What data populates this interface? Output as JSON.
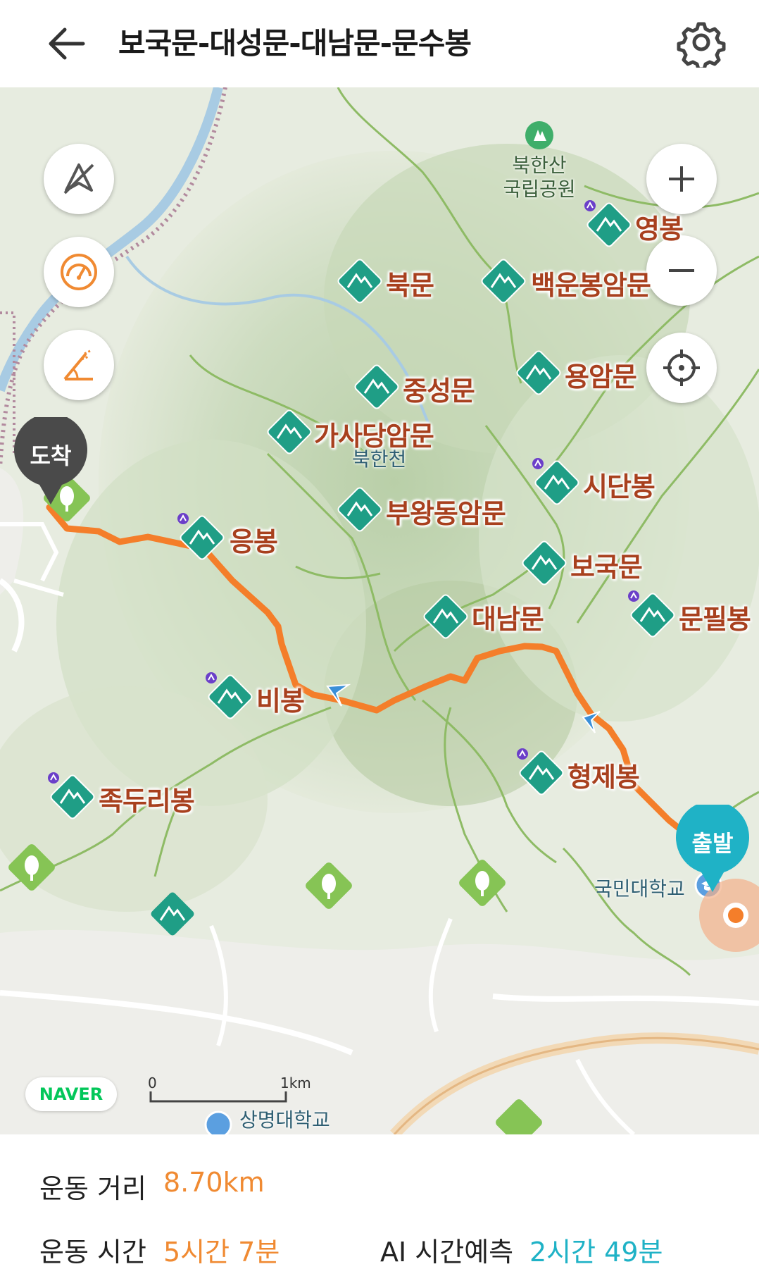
{
  "header": {
    "title": "보국문-대성문-대남문-문수봉"
  },
  "map": {
    "park_label": [
      "북한산",
      "국립공원"
    ],
    "stream_label": "북한천",
    "school_labels": [
      "국민대학교",
      "상명대학교"
    ],
    "peaks": [
      {
        "label": "영봉"
      },
      {
        "label": "북문"
      },
      {
        "label": "백운봉암문"
      },
      {
        "label": "용암문"
      },
      {
        "label": "중성문"
      },
      {
        "label": "가사당암문"
      },
      {
        "label": "시단봉"
      },
      {
        "label": "부왕동암문"
      },
      {
        "label": "응봉"
      },
      {
        "label": "보국문"
      },
      {
        "label": "대남문"
      },
      {
        "label": "문필봉"
      },
      {
        "label": "비봉"
      },
      {
        "label": "형제봉"
      },
      {
        "label": "족두리봉"
      }
    ],
    "markers": {
      "end": "도착",
      "start": "출발"
    },
    "naver_logo": "NAVER",
    "scale": {
      "start": "0",
      "end": "1km"
    },
    "colors": {
      "route": "#f47e2a",
      "peak_icon": "#1f9e86",
      "end_marker": "#4a4a4a",
      "start_marker": "#1fb2c6",
      "accent": "#f08a32"
    }
  },
  "stats": {
    "distance_label": "운동 거리",
    "distance_value": "8.70km",
    "time_label": "운동 시간",
    "time_value": "5시간 7분",
    "ai_label": "AI 시간예측",
    "ai_value": "2시간 49분"
  }
}
